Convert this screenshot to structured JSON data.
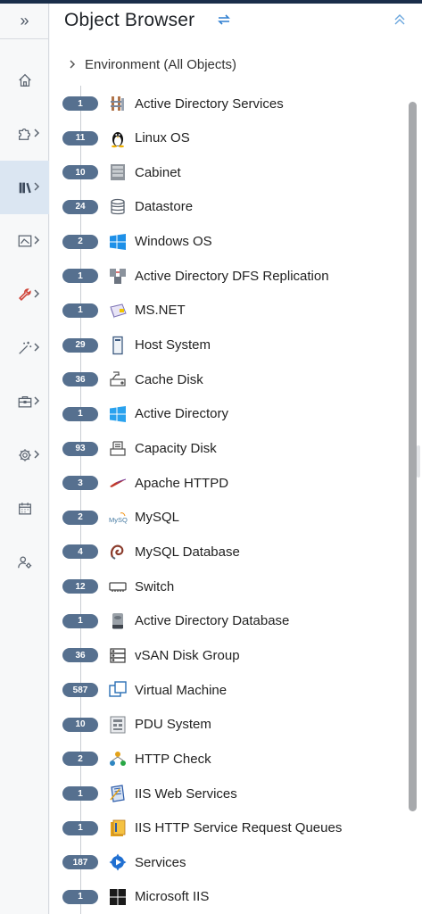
{
  "panel": {
    "title": "Object Browser",
    "environment_label": "Environment (All Objects)"
  },
  "rail": {
    "expand_glyph": "»",
    "items": [
      {
        "icon": "home-icon"
      },
      {
        "icon": "puzzle-icon"
      },
      {
        "icon": "library-icon"
      },
      {
        "icon": "dashboard-icon"
      },
      {
        "icon": "wrench-icon"
      },
      {
        "icon": "magic-wand-icon"
      },
      {
        "icon": "briefcase-icon"
      },
      {
        "icon": "gear-icon"
      },
      {
        "icon": "calendar-icon"
      },
      {
        "icon": "user-settings-icon"
      }
    ]
  },
  "objects": [
    {
      "count": "1",
      "label": "Active Directory Services",
      "icon": "ad-services-icon"
    },
    {
      "count": "11",
      "label": "Linux OS",
      "icon": "linux-penguin-icon"
    },
    {
      "count": "10",
      "label": "Cabinet",
      "icon": "cabinet-icon"
    },
    {
      "count": "24",
      "label": "Datastore",
      "icon": "datastore-icon"
    },
    {
      "count": "2",
      "label": "Windows OS",
      "icon": "windows-icon"
    },
    {
      "count": "1",
      "label": "Active Directory DFS Replication",
      "icon": "dfs-replication-icon"
    },
    {
      "count": "1",
      "label": "MS.NET",
      "icon": "msnet-icon"
    },
    {
      "count": "29",
      "label": "Host System",
      "icon": "host-system-icon"
    },
    {
      "count": "36",
      "label": "Cache Disk",
      "icon": "cache-disk-icon"
    },
    {
      "count": "1",
      "label": "Active Directory",
      "icon": "windows-active-directory-icon"
    },
    {
      "count": "93",
      "label": "Capacity Disk",
      "icon": "capacity-disk-icon"
    },
    {
      "count": "3",
      "label": "Apache HTTPD",
      "icon": "apache-feather-icon"
    },
    {
      "count": "2",
      "label": "MySQL",
      "icon": "mysql-icon"
    },
    {
      "count": "4",
      "label": "MySQL Database",
      "icon": "mysql-database-icon"
    },
    {
      "count": "12",
      "label": "Switch",
      "icon": "switch-icon"
    },
    {
      "count": "1",
      "label": "Active Directory Database",
      "icon": "ad-database-icon"
    },
    {
      "count": "36",
      "label": "vSAN Disk Group",
      "icon": "vsan-disk-group-icon"
    },
    {
      "count": "587",
      "label": "Virtual Machine",
      "icon": "virtual-machine-icon"
    },
    {
      "count": "10",
      "label": "PDU System",
      "icon": "pdu-system-icon"
    },
    {
      "count": "2",
      "label": "HTTP Check",
      "icon": "http-check-icon"
    },
    {
      "count": "1",
      "label": "IIS Web Services",
      "icon": "iis-web-services-icon"
    },
    {
      "count": "1",
      "label": "IIS HTTP Service Request Queues",
      "icon": "iis-queues-icon"
    },
    {
      "count": "187",
      "label": "Services",
      "icon": "services-gear-icon"
    },
    {
      "count": "1",
      "label": "Microsoft IIS",
      "icon": "microsoft-iis-icon"
    }
  ]
}
